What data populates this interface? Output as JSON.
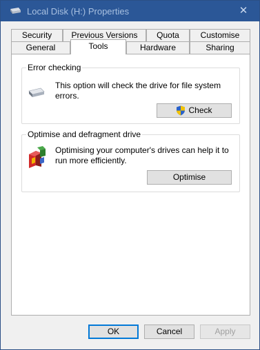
{
  "window": {
    "title": "Local Disk (H:) Properties",
    "close_glyph": "✕"
  },
  "tabs": {
    "row_back": [
      "Security",
      "Previous Versions",
      "Quota",
      "Customise"
    ],
    "row_front": [
      "General",
      "Tools",
      "Hardware",
      "Sharing"
    ],
    "active": "Tools"
  },
  "error_checking": {
    "label": "Error checking",
    "description": "This option will check the drive for file system errors.",
    "button_label": "Check",
    "button_icon": "uac-shield-icon"
  },
  "optimise": {
    "label": "Optimise and defragment drive",
    "description": "Optimising your computer's drives can help it to run more efficiently.",
    "button_label": "Optimise"
  },
  "footer": {
    "ok_label": "OK",
    "cancel_label": "Cancel",
    "apply_label": "Apply"
  },
  "colors": {
    "titlebar": "#2b5797",
    "title_text": "#a8c0e0",
    "accent": "#0078d7"
  }
}
